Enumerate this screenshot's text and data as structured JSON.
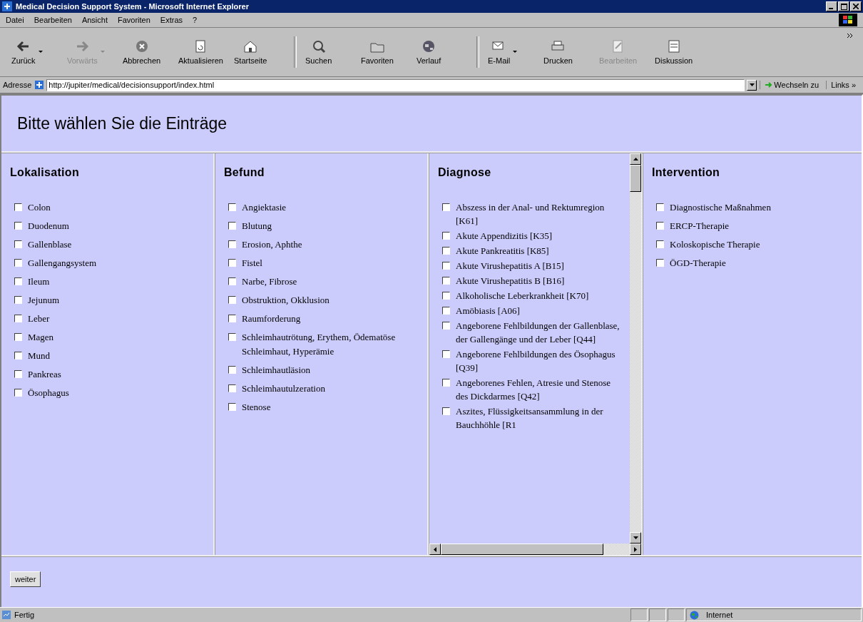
{
  "window": {
    "title": "Medical Decision Support System - Microsoft Internet Explorer"
  },
  "menu": [
    "Datei",
    "Bearbeiten",
    "Ansicht",
    "Favoriten",
    "Extras",
    "?"
  ],
  "toolbar": [
    {
      "label": "Zurück",
      "disabled": false,
      "dropdown": true
    },
    {
      "label": "Vorwärts",
      "disabled": true,
      "dropdown": true
    },
    {
      "label": "Abbrechen",
      "disabled": false,
      "dropdown": false
    },
    {
      "label": "Aktualisieren",
      "disabled": false,
      "dropdown": false
    },
    {
      "label": "Startseite",
      "disabled": false,
      "dropdown": false
    },
    {
      "label": "Suchen",
      "disabled": false,
      "dropdown": false
    },
    {
      "label": "Favoriten",
      "disabled": false,
      "dropdown": false
    },
    {
      "label": "Verlauf",
      "disabled": false,
      "dropdown": false
    },
    {
      "label": "E-Mail",
      "disabled": false,
      "dropdown": true
    },
    {
      "label": "Drucken",
      "disabled": false,
      "dropdown": false
    },
    {
      "label": "Bearbeiten",
      "disabled": true,
      "dropdown": false
    },
    {
      "label": "Diskussion",
      "disabled": false,
      "dropdown": false
    }
  ],
  "address": {
    "label": "Adresse",
    "value": "http://jupiter/medical/decisionsupport/index.html",
    "go": "Wechseln zu",
    "links": "Links »"
  },
  "page": {
    "heading": "Bitte wählen Sie die Einträge",
    "columns": [
      {
        "title": "Lokalisation",
        "scrollable": false,
        "items": [
          {
            "label": "Colon",
            "checked": false
          },
          {
            "label": "Duodenum",
            "checked": false
          },
          {
            "label": "Gallenblase",
            "checked": false
          },
          {
            "label": "Gallengangsystem",
            "checked": false
          },
          {
            "label": "Ileum",
            "checked": false
          },
          {
            "label": "Jejunum",
            "checked": false
          },
          {
            "label": "Leber",
            "checked": false
          },
          {
            "label": "Magen",
            "checked": false
          },
          {
            "label": "Mund",
            "checked": false
          },
          {
            "label": "Pankreas",
            "checked": false
          },
          {
            "label": "Ösophagus",
            "checked": false
          }
        ]
      },
      {
        "title": "Befund",
        "scrollable": false,
        "items": [
          {
            "label": "Angiektasie",
            "checked": false
          },
          {
            "label": "Blutung",
            "checked": false
          },
          {
            "label": "Erosion, Aphthe",
            "checked": false
          },
          {
            "label": "Fistel",
            "checked": false
          },
          {
            "label": "Narbe, Fibrose",
            "checked": false
          },
          {
            "label": "Obstruktion, Okklusion",
            "checked": false
          },
          {
            "label": "Raumforderung",
            "checked": false
          },
          {
            "label": "Schleimhautrötung, Erythem, Ödematöse Schleimhaut, Hyperämie",
            "checked": false
          },
          {
            "label": "Schleimhautläsion",
            "checked": false
          },
          {
            "label": "Schleimhautulzeration",
            "checked": false
          },
          {
            "label": "Stenose",
            "checked": false
          }
        ]
      },
      {
        "title": "Diagnose",
        "scrollable": true,
        "items": [
          {
            "label": "Abszess in der Anal- und Rektumregion [K61]",
            "checked": false
          },
          {
            "label": "Akute Appendizitis [K35]",
            "checked": false
          },
          {
            "label": "Akute Pankreatitis [K85]",
            "checked": false
          },
          {
            "label": "Akute Virushepatitis A [B15]",
            "checked": false
          },
          {
            "label": "Akute Virushepatitis B [B16]",
            "checked": false
          },
          {
            "label": "Alkoholische Leberkrankheit [K70]",
            "checked": false
          },
          {
            "label": "Amöbiasis [A06]",
            "checked": false
          },
          {
            "label": "Angeborene Fehlbildungen der Gallenblase, der Gallengänge und der Leber [Q44]",
            "checked": false
          },
          {
            "label": "Angeborene Fehlbildungen des Ösophagus [Q39]",
            "checked": false
          },
          {
            "label": "Angeborenes Fehlen, Atresie und Stenose des Dickdarmes [Q42]",
            "checked": false
          },
          {
            "label": "Aszites, Flüssigkeitsansammlung in der Bauchhöhle [R1",
            "checked": false
          }
        ]
      },
      {
        "title": "Intervention",
        "scrollable": false,
        "items": [
          {
            "label": "Diagnostische Maßnahmen",
            "checked": false
          },
          {
            "label": "ERCP-Therapie",
            "checked": false
          },
          {
            "label": "Koloskopische Therapie",
            "checked": false
          },
          {
            "label": "ÖGD-Therapie",
            "checked": false
          }
        ]
      }
    ],
    "button": "weiter"
  },
  "status_bar": {
    "text": "Fertig",
    "zone": "Internet"
  }
}
